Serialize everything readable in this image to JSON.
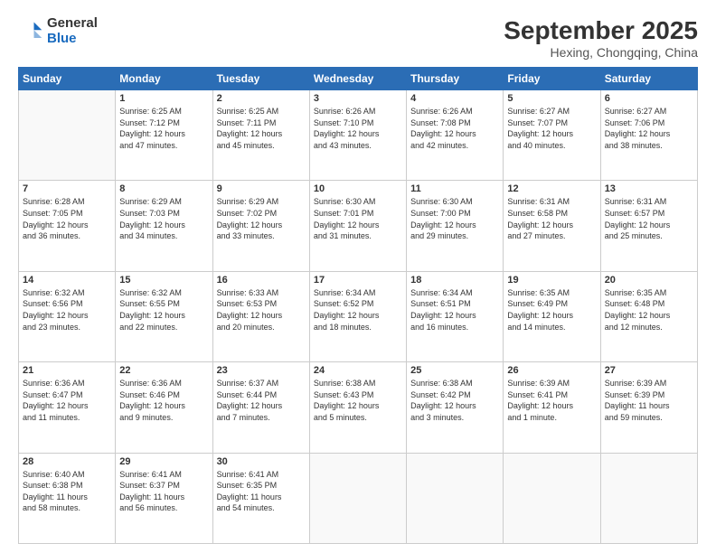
{
  "logo": {
    "general": "General",
    "blue": "Blue"
  },
  "title": "September 2025",
  "location": "Hexing, Chongqing, China",
  "days_header": [
    "Sunday",
    "Monday",
    "Tuesday",
    "Wednesday",
    "Thursday",
    "Friday",
    "Saturday"
  ],
  "weeks": [
    [
      {
        "day": "",
        "info": ""
      },
      {
        "day": "1",
        "info": "Sunrise: 6:25 AM\nSunset: 7:12 PM\nDaylight: 12 hours\nand 47 minutes."
      },
      {
        "day": "2",
        "info": "Sunrise: 6:25 AM\nSunset: 7:11 PM\nDaylight: 12 hours\nand 45 minutes."
      },
      {
        "day": "3",
        "info": "Sunrise: 6:26 AM\nSunset: 7:10 PM\nDaylight: 12 hours\nand 43 minutes."
      },
      {
        "day": "4",
        "info": "Sunrise: 6:26 AM\nSunset: 7:08 PM\nDaylight: 12 hours\nand 42 minutes."
      },
      {
        "day": "5",
        "info": "Sunrise: 6:27 AM\nSunset: 7:07 PM\nDaylight: 12 hours\nand 40 minutes."
      },
      {
        "day": "6",
        "info": "Sunrise: 6:27 AM\nSunset: 7:06 PM\nDaylight: 12 hours\nand 38 minutes."
      }
    ],
    [
      {
        "day": "7",
        "info": "Sunrise: 6:28 AM\nSunset: 7:05 PM\nDaylight: 12 hours\nand 36 minutes."
      },
      {
        "day": "8",
        "info": "Sunrise: 6:29 AM\nSunset: 7:03 PM\nDaylight: 12 hours\nand 34 minutes."
      },
      {
        "day": "9",
        "info": "Sunrise: 6:29 AM\nSunset: 7:02 PM\nDaylight: 12 hours\nand 33 minutes."
      },
      {
        "day": "10",
        "info": "Sunrise: 6:30 AM\nSunset: 7:01 PM\nDaylight: 12 hours\nand 31 minutes."
      },
      {
        "day": "11",
        "info": "Sunrise: 6:30 AM\nSunset: 7:00 PM\nDaylight: 12 hours\nand 29 minutes."
      },
      {
        "day": "12",
        "info": "Sunrise: 6:31 AM\nSunset: 6:58 PM\nDaylight: 12 hours\nand 27 minutes."
      },
      {
        "day": "13",
        "info": "Sunrise: 6:31 AM\nSunset: 6:57 PM\nDaylight: 12 hours\nand 25 minutes."
      }
    ],
    [
      {
        "day": "14",
        "info": "Sunrise: 6:32 AM\nSunset: 6:56 PM\nDaylight: 12 hours\nand 23 minutes."
      },
      {
        "day": "15",
        "info": "Sunrise: 6:32 AM\nSunset: 6:55 PM\nDaylight: 12 hours\nand 22 minutes."
      },
      {
        "day": "16",
        "info": "Sunrise: 6:33 AM\nSunset: 6:53 PM\nDaylight: 12 hours\nand 20 minutes."
      },
      {
        "day": "17",
        "info": "Sunrise: 6:34 AM\nSunset: 6:52 PM\nDaylight: 12 hours\nand 18 minutes."
      },
      {
        "day": "18",
        "info": "Sunrise: 6:34 AM\nSunset: 6:51 PM\nDaylight: 12 hours\nand 16 minutes."
      },
      {
        "day": "19",
        "info": "Sunrise: 6:35 AM\nSunset: 6:49 PM\nDaylight: 12 hours\nand 14 minutes."
      },
      {
        "day": "20",
        "info": "Sunrise: 6:35 AM\nSunset: 6:48 PM\nDaylight: 12 hours\nand 12 minutes."
      }
    ],
    [
      {
        "day": "21",
        "info": "Sunrise: 6:36 AM\nSunset: 6:47 PM\nDaylight: 12 hours\nand 11 minutes."
      },
      {
        "day": "22",
        "info": "Sunrise: 6:36 AM\nSunset: 6:46 PM\nDaylight: 12 hours\nand 9 minutes."
      },
      {
        "day": "23",
        "info": "Sunrise: 6:37 AM\nSunset: 6:44 PM\nDaylight: 12 hours\nand 7 minutes."
      },
      {
        "day": "24",
        "info": "Sunrise: 6:38 AM\nSunset: 6:43 PM\nDaylight: 12 hours\nand 5 minutes."
      },
      {
        "day": "25",
        "info": "Sunrise: 6:38 AM\nSunset: 6:42 PM\nDaylight: 12 hours\nand 3 minutes."
      },
      {
        "day": "26",
        "info": "Sunrise: 6:39 AM\nSunset: 6:41 PM\nDaylight: 12 hours\nand 1 minute."
      },
      {
        "day": "27",
        "info": "Sunrise: 6:39 AM\nSunset: 6:39 PM\nDaylight: 11 hours\nand 59 minutes."
      }
    ],
    [
      {
        "day": "28",
        "info": "Sunrise: 6:40 AM\nSunset: 6:38 PM\nDaylight: 11 hours\nand 58 minutes."
      },
      {
        "day": "29",
        "info": "Sunrise: 6:41 AM\nSunset: 6:37 PM\nDaylight: 11 hours\nand 56 minutes."
      },
      {
        "day": "30",
        "info": "Sunrise: 6:41 AM\nSunset: 6:35 PM\nDaylight: 11 hours\nand 54 minutes."
      },
      {
        "day": "",
        "info": ""
      },
      {
        "day": "",
        "info": ""
      },
      {
        "day": "",
        "info": ""
      },
      {
        "day": "",
        "info": ""
      }
    ]
  ]
}
